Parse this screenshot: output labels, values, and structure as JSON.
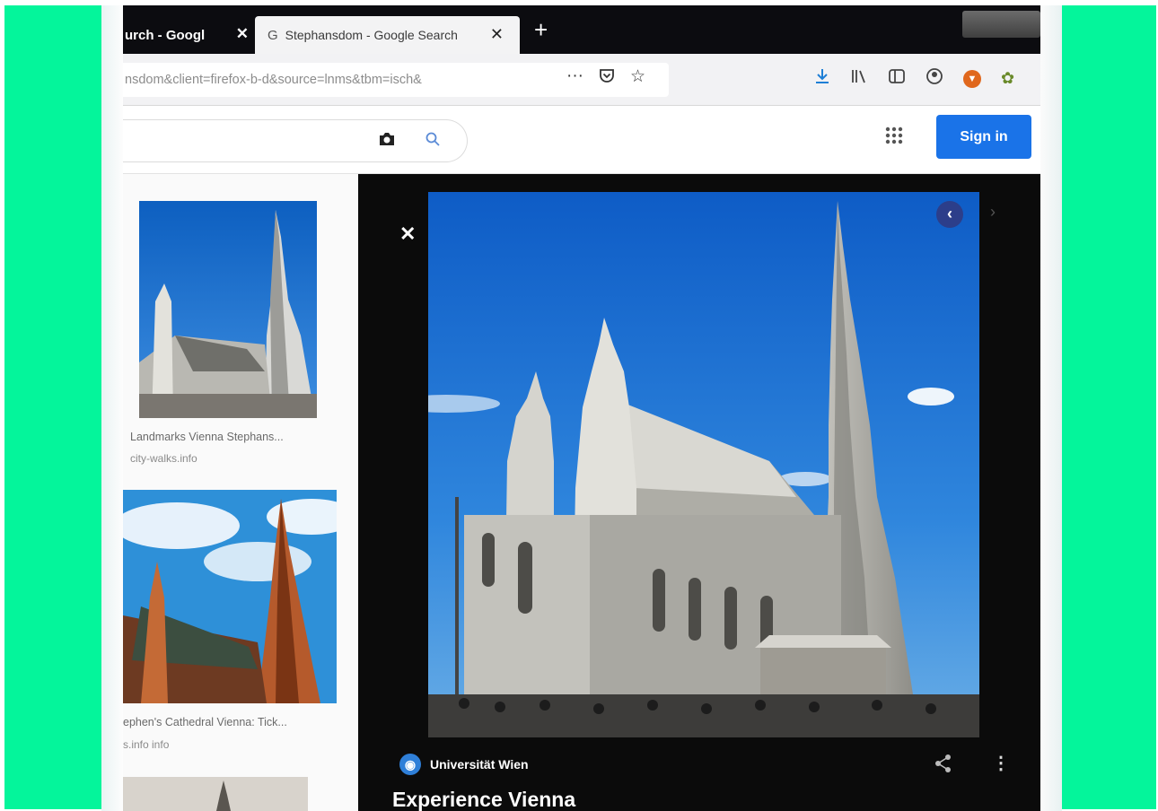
{
  "colors": {
    "side_panels": "#04f59b",
    "tabstrip": "#0c0c10",
    "signin_button": "#1a73e8",
    "viewer_bg": "#0b0b0b"
  },
  "tabs": {
    "inactive": {
      "label": "urch - Googl",
      "close_glyph": "✕"
    },
    "active": {
      "favicon": "G",
      "label": "Stephansdom - Google Search",
      "close_glyph": "✕"
    },
    "new_tab_glyph": "+"
  },
  "toolbar": {
    "url": "nsdom&client=firefox-b-d&source=lnms&tbm=isch&",
    "icons": [
      "more-icon",
      "pocket-icon",
      "bookmark-star-icon",
      "download-icon",
      "library-icon",
      "sidebar-icon",
      "account-icon",
      "extension-icon",
      "extension2-icon"
    ]
  },
  "google": {
    "camera_icon": "camera-icon",
    "search_icon": "search-icon",
    "apps_icon": "apps-grid-icon",
    "sign_in_label": "Sign in"
  },
  "results": [
    {
      "caption": "Landmarks Vienna Stephans...",
      "source": "city-walks.info"
    },
    {
      "caption": "ephen's Cathedral Vienna: Tick...",
      "source": "s.info info"
    }
  ],
  "viewer": {
    "close_glyph": "✕",
    "prev_glyph": "‹",
    "next_glyph": "›",
    "source_name": "Universität Wien",
    "title": "Experience Vienna",
    "more_glyph": "⋮",
    "share_glyph": "<"
  }
}
